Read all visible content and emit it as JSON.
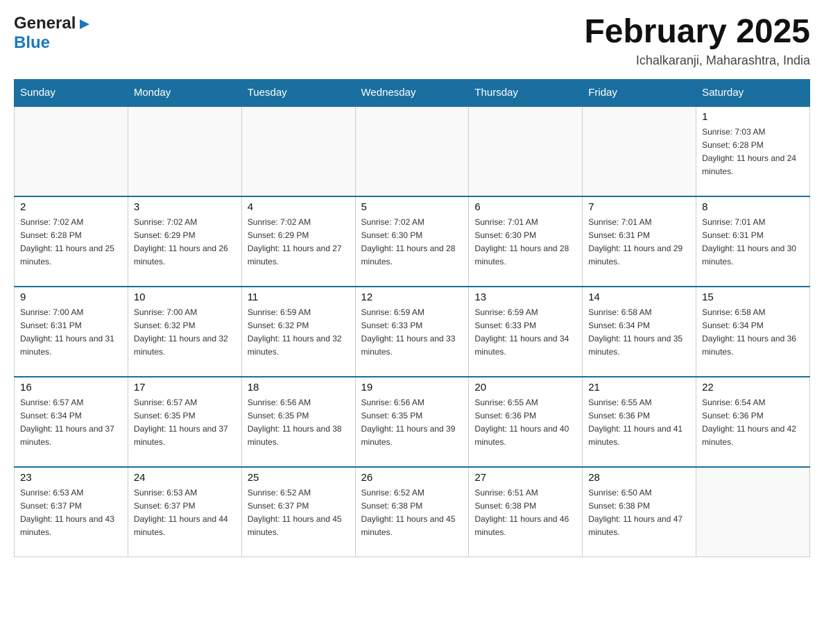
{
  "header": {
    "logo": {
      "general": "General",
      "blue": "Blue",
      "arrow": "▶"
    },
    "title": "February 2025",
    "location": "Ichalkaranji, Maharashtra, India"
  },
  "days_of_week": [
    "Sunday",
    "Monday",
    "Tuesday",
    "Wednesday",
    "Thursday",
    "Friday",
    "Saturday"
  ],
  "weeks": [
    [
      {
        "day": "",
        "info": ""
      },
      {
        "day": "",
        "info": ""
      },
      {
        "day": "",
        "info": ""
      },
      {
        "day": "",
        "info": ""
      },
      {
        "day": "",
        "info": ""
      },
      {
        "day": "",
        "info": ""
      },
      {
        "day": "1",
        "info": "Sunrise: 7:03 AM\nSunset: 6:28 PM\nDaylight: 11 hours and 24 minutes."
      }
    ],
    [
      {
        "day": "2",
        "info": "Sunrise: 7:02 AM\nSunset: 6:28 PM\nDaylight: 11 hours and 25 minutes."
      },
      {
        "day": "3",
        "info": "Sunrise: 7:02 AM\nSunset: 6:29 PM\nDaylight: 11 hours and 26 minutes."
      },
      {
        "day": "4",
        "info": "Sunrise: 7:02 AM\nSunset: 6:29 PM\nDaylight: 11 hours and 27 minutes."
      },
      {
        "day": "5",
        "info": "Sunrise: 7:02 AM\nSunset: 6:30 PM\nDaylight: 11 hours and 28 minutes."
      },
      {
        "day": "6",
        "info": "Sunrise: 7:01 AM\nSunset: 6:30 PM\nDaylight: 11 hours and 28 minutes."
      },
      {
        "day": "7",
        "info": "Sunrise: 7:01 AM\nSunset: 6:31 PM\nDaylight: 11 hours and 29 minutes."
      },
      {
        "day": "8",
        "info": "Sunrise: 7:01 AM\nSunset: 6:31 PM\nDaylight: 11 hours and 30 minutes."
      }
    ],
    [
      {
        "day": "9",
        "info": "Sunrise: 7:00 AM\nSunset: 6:31 PM\nDaylight: 11 hours and 31 minutes."
      },
      {
        "day": "10",
        "info": "Sunrise: 7:00 AM\nSunset: 6:32 PM\nDaylight: 11 hours and 32 minutes."
      },
      {
        "day": "11",
        "info": "Sunrise: 6:59 AM\nSunset: 6:32 PM\nDaylight: 11 hours and 32 minutes."
      },
      {
        "day": "12",
        "info": "Sunrise: 6:59 AM\nSunset: 6:33 PM\nDaylight: 11 hours and 33 minutes."
      },
      {
        "day": "13",
        "info": "Sunrise: 6:59 AM\nSunset: 6:33 PM\nDaylight: 11 hours and 34 minutes."
      },
      {
        "day": "14",
        "info": "Sunrise: 6:58 AM\nSunset: 6:34 PM\nDaylight: 11 hours and 35 minutes."
      },
      {
        "day": "15",
        "info": "Sunrise: 6:58 AM\nSunset: 6:34 PM\nDaylight: 11 hours and 36 minutes."
      }
    ],
    [
      {
        "day": "16",
        "info": "Sunrise: 6:57 AM\nSunset: 6:34 PM\nDaylight: 11 hours and 37 minutes."
      },
      {
        "day": "17",
        "info": "Sunrise: 6:57 AM\nSunset: 6:35 PM\nDaylight: 11 hours and 37 minutes."
      },
      {
        "day": "18",
        "info": "Sunrise: 6:56 AM\nSunset: 6:35 PM\nDaylight: 11 hours and 38 minutes."
      },
      {
        "day": "19",
        "info": "Sunrise: 6:56 AM\nSunset: 6:35 PM\nDaylight: 11 hours and 39 minutes."
      },
      {
        "day": "20",
        "info": "Sunrise: 6:55 AM\nSunset: 6:36 PM\nDaylight: 11 hours and 40 minutes."
      },
      {
        "day": "21",
        "info": "Sunrise: 6:55 AM\nSunset: 6:36 PM\nDaylight: 11 hours and 41 minutes."
      },
      {
        "day": "22",
        "info": "Sunrise: 6:54 AM\nSunset: 6:36 PM\nDaylight: 11 hours and 42 minutes."
      }
    ],
    [
      {
        "day": "23",
        "info": "Sunrise: 6:53 AM\nSunset: 6:37 PM\nDaylight: 11 hours and 43 minutes."
      },
      {
        "day": "24",
        "info": "Sunrise: 6:53 AM\nSunset: 6:37 PM\nDaylight: 11 hours and 44 minutes."
      },
      {
        "day": "25",
        "info": "Sunrise: 6:52 AM\nSunset: 6:37 PM\nDaylight: 11 hours and 45 minutes."
      },
      {
        "day": "26",
        "info": "Sunrise: 6:52 AM\nSunset: 6:38 PM\nDaylight: 11 hours and 45 minutes."
      },
      {
        "day": "27",
        "info": "Sunrise: 6:51 AM\nSunset: 6:38 PM\nDaylight: 11 hours and 46 minutes."
      },
      {
        "day": "28",
        "info": "Sunrise: 6:50 AM\nSunset: 6:38 PM\nDaylight: 11 hours and 47 minutes."
      },
      {
        "day": "",
        "info": ""
      }
    ]
  ]
}
